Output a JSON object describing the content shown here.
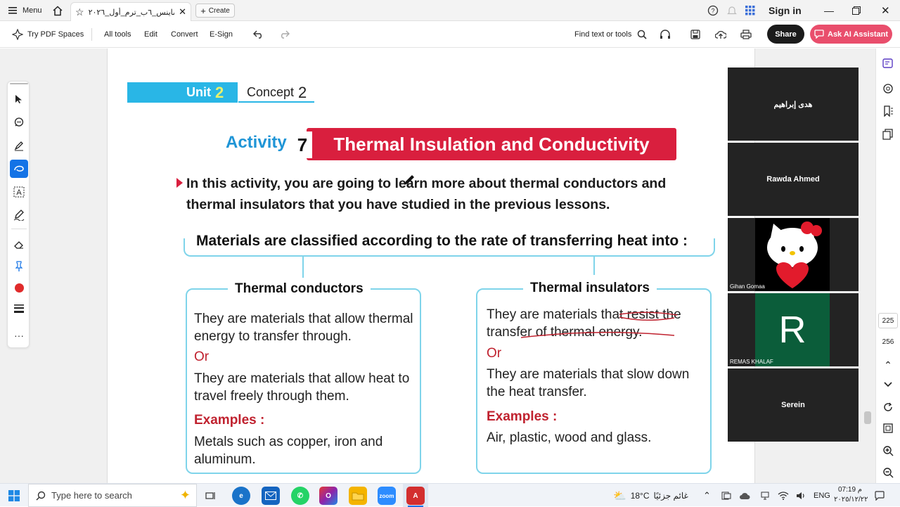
{
  "titlebar": {
    "menu_label": "Menu",
    "tab_title": "ساينس_٦ب_ترم_أول_٢٠٢٦ ...",
    "create_label": "Create",
    "sign_in": "Sign in"
  },
  "toolbar": {
    "pdf_spaces": "Try PDF Spaces",
    "all_tools": "All tools",
    "edit": "Edit",
    "convert": "Convert",
    "esign": "E-Sign",
    "find": "Find text or tools",
    "share": "Share",
    "ai_assistant": "Ask AI Assistant"
  },
  "document": {
    "unit_word": "Unit",
    "unit_num": "2",
    "concept_word": "Concept",
    "concept_num": "2",
    "activity_word": "Activity",
    "activity_num": "7",
    "activity_title": "Thermal Insulation and Conductivity",
    "intro": "In this activity, you are going to learn more about thermal conductors and thermal insulators that you have studied in the previous lessons.",
    "classified": "Materials are classified according to the rate of transferring heat into :",
    "conductors": {
      "title": "Thermal conductors",
      "def1": "They are materials that allow thermal energy to transfer through.",
      "or": "Or",
      "def2": "They are materials that allow heat to travel freely through them.",
      "examples_label": "Examples :",
      "examples": "Metals such as copper, iron and aluminum."
    },
    "insulators": {
      "title": "Thermal insulators",
      "def1": "They are materials that resist the transfer of thermal energy.",
      "or": "Or",
      "def2": "They are materials that slow down the heat transfer.",
      "examples_label": "Examples :",
      "examples": "Air, plastic, wood and glass."
    }
  },
  "participants": [
    {
      "name": "هدى إبراهيم"
    },
    {
      "name": "Rawda Ahmed"
    },
    {
      "name": "Gihan Gomaa"
    },
    {
      "name": "REMAS KHALAF",
      "initial": "R"
    },
    {
      "name": "Serein"
    }
  ],
  "pager": {
    "current": "225",
    "total": "256"
  },
  "taskbar": {
    "search_placeholder": "Type here to search",
    "weather_temp": "18°C",
    "weather_text": "غائم جزئيًا",
    "lang": "ENG",
    "time": "07:19 م",
    "date": "٢٠٢٥/١٢/٢٢"
  },
  "colors": {
    "activity_red": "#d91f3e",
    "unit_blue": "#29b6e6",
    "brace_cyan": "#7fd4ea",
    "ai_pink": "#e94e6c"
  }
}
